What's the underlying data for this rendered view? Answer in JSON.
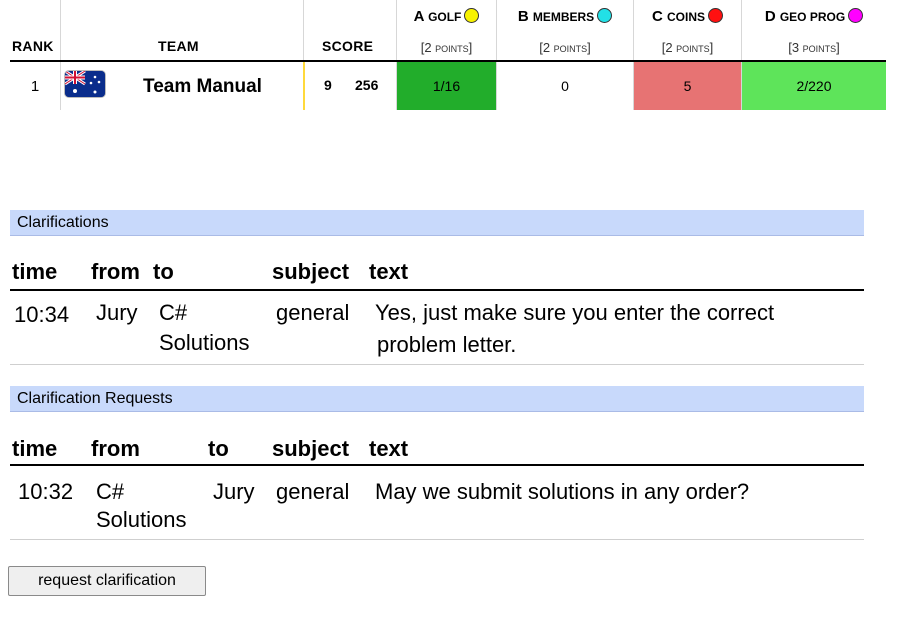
{
  "scoreboard": {
    "headers": {
      "rank": "RANK",
      "team": "TEAM",
      "score": "SCORE"
    },
    "problems": [
      {
        "letter": "A",
        "name": "Golf",
        "points": "[2 points]",
        "color": "#f7f200"
      },
      {
        "letter": "B",
        "name": "Members",
        "points": "[2 points]",
        "color": "#22e0e6"
      },
      {
        "letter": "C",
        "name": "Coins",
        "points": "[2 points]",
        "color": "#ff1010"
      },
      {
        "letter": "D",
        "name": "Geo Prog",
        "points": "[3 points]",
        "color": "#ff00ff"
      }
    ],
    "row": {
      "rank": "1",
      "flag": "australia-flag-icon",
      "team": "Team Manual",
      "solved": "9",
      "time": "256",
      "results": [
        {
          "text": "1/16",
          "bg": "#22ad2b"
        },
        {
          "text": "0",
          "bg": "#ffffff"
        },
        {
          "text": "5",
          "bg": "#e77373"
        },
        {
          "text": "2/220",
          "bg": "#5ee45a"
        }
      ]
    }
  },
  "clarifications": {
    "title": "Clarifications",
    "columns": {
      "time": "time",
      "from": "from",
      "to": "to",
      "subject": "subject",
      "text": "text"
    },
    "rows": [
      {
        "time": "10:34",
        "from": "Jury",
        "to_line1": "C#",
        "to_line2": "Solutions",
        "subject": "general",
        "text_line1": "Yes, just make sure you enter the correct",
        "text_line2": "problem letter."
      }
    ]
  },
  "requests": {
    "title": "Clarification Requests",
    "columns": {
      "time": "time",
      "from": "from",
      "to": "to",
      "subject": "subject",
      "text": "text"
    },
    "rows": [
      {
        "time": "10:32",
        "from_line1": "C#",
        "from_line2": "Solutions",
        "to": "Jury",
        "subject": "general",
        "text": "May we submit solutions in any order?"
      }
    ]
  },
  "request_button": "request clarification"
}
